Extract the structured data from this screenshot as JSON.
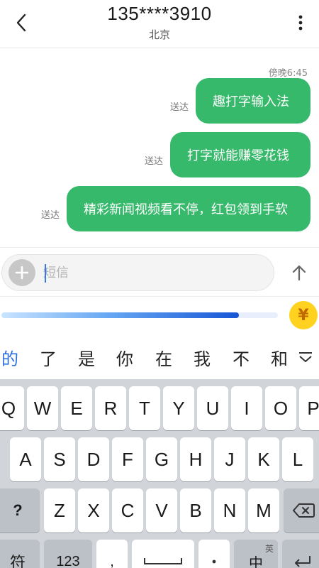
{
  "header": {
    "title": "135****3910",
    "subtitle": "北京"
  },
  "messages": {
    "timestamp": "傍晚6:45",
    "items": [
      {
        "text": "趣打字输入法",
        "status": "送达"
      },
      {
        "text": "打字就能赚零花钱",
        "status": "送达"
      },
      {
        "text": "精彩新闻视频看不停，红包领到手软",
        "status": "送达"
      }
    ]
  },
  "input": {
    "placeholder": "短信"
  },
  "ime": {
    "progress": 0.86,
    "coin_symbol": "¥"
  },
  "candidates": [
    "的",
    "了",
    "是",
    "你",
    "在",
    "我",
    "不",
    "和"
  ],
  "keyboard": {
    "row1": [
      "Q",
      "W",
      "E",
      "R",
      "T",
      "Y",
      "U",
      "I",
      "O",
      "P"
    ],
    "row2": [
      "A",
      "S",
      "D",
      "F",
      "G",
      "H",
      "J",
      "K",
      "L"
    ],
    "row3": [
      "Z",
      "X",
      "C",
      "V",
      "B",
      "N",
      "M"
    ],
    "shift_label": "?",
    "symbol_label": "符",
    "numbers_label": "123",
    "lang_label": "中",
    "lang_sub_label": "英",
    "comma_label": ","
  },
  "colors": {
    "bubble": "#36b96a",
    "accent": "#2e6fe0",
    "coin": "#ffd21f"
  }
}
